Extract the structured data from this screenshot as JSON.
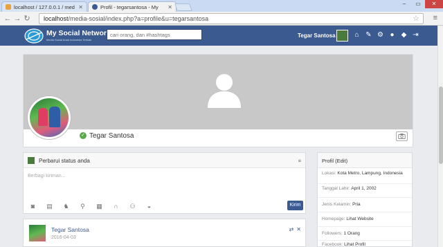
{
  "browser": {
    "tabs": [
      {
        "title": "localhost / 127.0.0.1 / med",
        "active": false
      },
      {
        "title": "Profil - tegarsantosa - My",
        "active": true
      }
    ],
    "url_host": "localhost",
    "url_path": "/media-sosial/index.php?a=profile&u=tegarsantosa"
  },
  "site": {
    "title": "My Social Network",
    "tagline": "Media Sosial Anak Indonesia Terbaik",
    "search_placeholder": "cari orang, dan #hashtags",
    "user_name": "Tegar Santosa",
    "nav_icons": [
      "home-icon",
      "edit-icon",
      "settings-icon",
      "chat-icon",
      "notification-icon",
      "logout-icon"
    ]
  },
  "profile": {
    "name": "Tegar Santosa"
  },
  "status": {
    "title": "Perbarui status anda",
    "placeholder": "Berbagi kiriman...",
    "submit_label": "Kirim",
    "attach_icons": [
      "camera-icon",
      "ticket-icon",
      "game-icon",
      "location-icon",
      "film-icon",
      "headphones-icon",
      "gamepad-icon",
      "food-icon"
    ]
  },
  "post": {
    "author": "Tegar Santosa",
    "date": "2016-04-03"
  },
  "info": {
    "title": "Profil (Edit)",
    "rows": [
      {
        "label": "Lokasi:",
        "value": "Kota Metro, Lampung, Indonesia"
      },
      {
        "label": "Tanggal Lahir:",
        "value": "April 1, 2002"
      },
      {
        "label": "Jenis Kelamin:",
        "value": "Pria"
      },
      {
        "label": "Homepage:",
        "value": "Lihat Website"
      },
      {
        "label": "Followers:",
        "value": "1 Orang"
      },
      {
        "label": "Facebook:",
        "value": "Lihat Profil"
      }
    ]
  },
  "colors": {
    "header_bg": "#3b5a8f",
    "page_bg": "#e9ebee",
    "cover_bg": "#c8c8c8",
    "verified": "#5aa94a"
  }
}
